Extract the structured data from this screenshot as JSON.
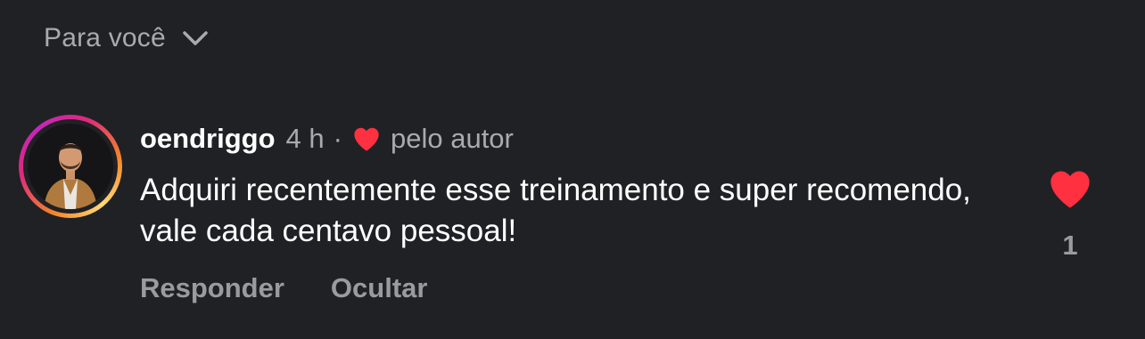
{
  "filter": {
    "label": "Para você",
    "icon": "chevron-down-icon"
  },
  "comment": {
    "avatar_icon": "profile-photo",
    "username": "oendriggo",
    "time": "4 h",
    "separator": "·",
    "liked_by_label": "pelo autor",
    "liked_by_icon": "heart-icon",
    "text": "Adquiri recentemente esse treinamento e super recomendo, vale cada centavo pessoal!",
    "actions": {
      "reply": "Responder",
      "hide": "Ocultar"
    },
    "like_count": "1",
    "like_icon": "heart-filled-icon"
  },
  "colors": {
    "background": "#202125",
    "text_primary": "#ffffff",
    "text_secondary": "#a9aaaf",
    "like_red": "#ff3040"
  }
}
